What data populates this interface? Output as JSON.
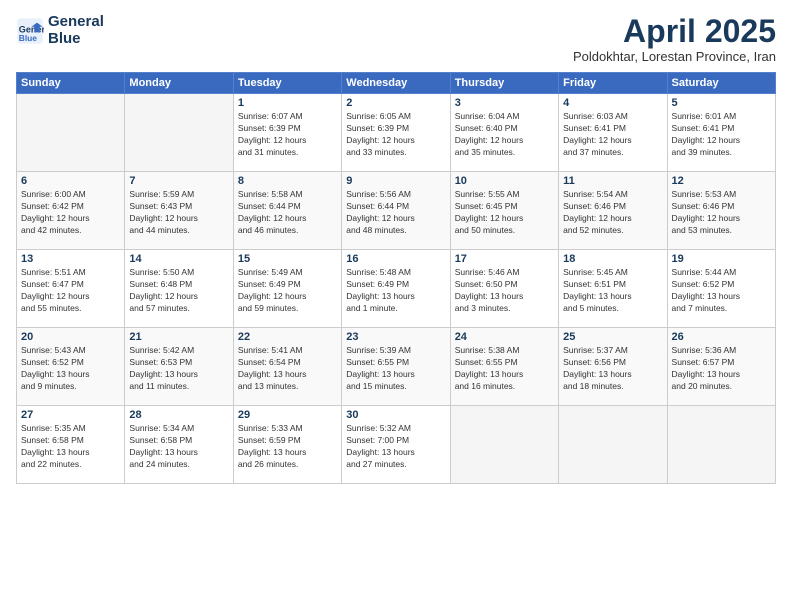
{
  "logo": {
    "line1": "General",
    "line2": "Blue"
  },
  "title": "April 2025",
  "location": "Poldokhtar, Lorestan Province, Iran",
  "weekdays": [
    "Sunday",
    "Monday",
    "Tuesday",
    "Wednesday",
    "Thursday",
    "Friday",
    "Saturday"
  ],
  "days": [
    {
      "num": "",
      "info": ""
    },
    {
      "num": "",
      "info": ""
    },
    {
      "num": "1",
      "info": "Sunrise: 6:07 AM\nSunset: 6:39 PM\nDaylight: 12 hours\nand 31 minutes."
    },
    {
      "num": "2",
      "info": "Sunrise: 6:05 AM\nSunset: 6:39 PM\nDaylight: 12 hours\nand 33 minutes."
    },
    {
      "num": "3",
      "info": "Sunrise: 6:04 AM\nSunset: 6:40 PM\nDaylight: 12 hours\nand 35 minutes."
    },
    {
      "num": "4",
      "info": "Sunrise: 6:03 AM\nSunset: 6:41 PM\nDaylight: 12 hours\nand 37 minutes."
    },
    {
      "num": "5",
      "info": "Sunrise: 6:01 AM\nSunset: 6:41 PM\nDaylight: 12 hours\nand 39 minutes."
    },
    {
      "num": "6",
      "info": "Sunrise: 6:00 AM\nSunset: 6:42 PM\nDaylight: 12 hours\nand 42 minutes."
    },
    {
      "num": "7",
      "info": "Sunrise: 5:59 AM\nSunset: 6:43 PM\nDaylight: 12 hours\nand 44 minutes."
    },
    {
      "num": "8",
      "info": "Sunrise: 5:58 AM\nSunset: 6:44 PM\nDaylight: 12 hours\nand 46 minutes."
    },
    {
      "num": "9",
      "info": "Sunrise: 5:56 AM\nSunset: 6:44 PM\nDaylight: 12 hours\nand 48 minutes."
    },
    {
      "num": "10",
      "info": "Sunrise: 5:55 AM\nSunset: 6:45 PM\nDaylight: 12 hours\nand 50 minutes."
    },
    {
      "num": "11",
      "info": "Sunrise: 5:54 AM\nSunset: 6:46 PM\nDaylight: 12 hours\nand 52 minutes."
    },
    {
      "num": "12",
      "info": "Sunrise: 5:53 AM\nSunset: 6:46 PM\nDaylight: 12 hours\nand 53 minutes."
    },
    {
      "num": "13",
      "info": "Sunrise: 5:51 AM\nSunset: 6:47 PM\nDaylight: 12 hours\nand 55 minutes."
    },
    {
      "num": "14",
      "info": "Sunrise: 5:50 AM\nSunset: 6:48 PM\nDaylight: 12 hours\nand 57 minutes."
    },
    {
      "num": "15",
      "info": "Sunrise: 5:49 AM\nSunset: 6:49 PM\nDaylight: 12 hours\nand 59 minutes."
    },
    {
      "num": "16",
      "info": "Sunrise: 5:48 AM\nSunset: 6:49 PM\nDaylight: 13 hours\nand 1 minute."
    },
    {
      "num": "17",
      "info": "Sunrise: 5:46 AM\nSunset: 6:50 PM\nDaylight: 13 hours\nand 3 minutes."
    },
    {
      "num": "18",
      "info": "Sunrise: 5:45 AM\nSunset: 6:51 PM\nDaylight: 13 hours\nand 5 minutes."
    },
    {
      "num": "19",
      "info": "Sunrise: 5:44 AM\nSunset: 6:52 PM\nDaylight: 13 hours\nand 7 minutes."
    },
    {
      "num": "20",
      "info": "Sunrise: 5:43 AM\nSunset: 6:52 PM\nDaylight: 13 hours\nand 9 minutes."
    },
    {
      "num": "21",
      "info": "Sunrise: 5:42 AM\nSunset: 6:53 PM\nDaylight: 13 hours\nand 11 minutes."
    },
    {
      "num": "22",
      "info": "Sunrise: 5:41 AM\nSunset: 6:54 PM\nDaylight: 13 hours\nand 13 minutes."
    },
    {
      "num": "23",
      "info": "Sunrise: 5:39 AM\nSunset: 6:55 PM\nDaylight: 13 hours\nand 15 minutes."
    },
    {
      "num": "24",
      "info": "Sunrise: 5:38 AM\nSunset: 6:55 PM\nDaylight: 13 hours\nand 16 minutes."
    },
    {
      "num": "25",
      "info": "Sunrise: 5:37 AM\nSunset: 6:56 PM\nDaylight: 13 hours\nand 18 minutes."
    },
    {
      "num": "26",
      "info": "Sunrise: 5:36 AM\nSunset: 6:57 PM\nDaylight: 13 hours\nand 20 minutes."
    },
    {
      "num": "27",
      "info": "Sunrise: 5:35 AM\nSunset: 6:58 PM\nDaylight: 13 hours\nand 22 minutes."
    },
    {
      "num": "28",
      "info": "Sunrise: 5:34 AM\nSunset: 6:58 PM\nDaylight: 13 hours\nand 24 minutes."
    },
    {
      "num": "29",
      "info": "Sunrise: 5:33 AM\nSunset: 6:59 PM\nDaylight: 13 hours\nand 26 minutes."
    },
    {
      "num": "30",
      "info": "Sunrise: 5:32 AM\nSunset: 7:00 PM\nDaylight: 13 hours\nand 27 minutes."
    },
    {
      "num": "",
      "info": ""
    },
    {
      "num": "",
      "info": ""
    },
    {
      "num": "",
      "info": ""
    }
  ]
}
